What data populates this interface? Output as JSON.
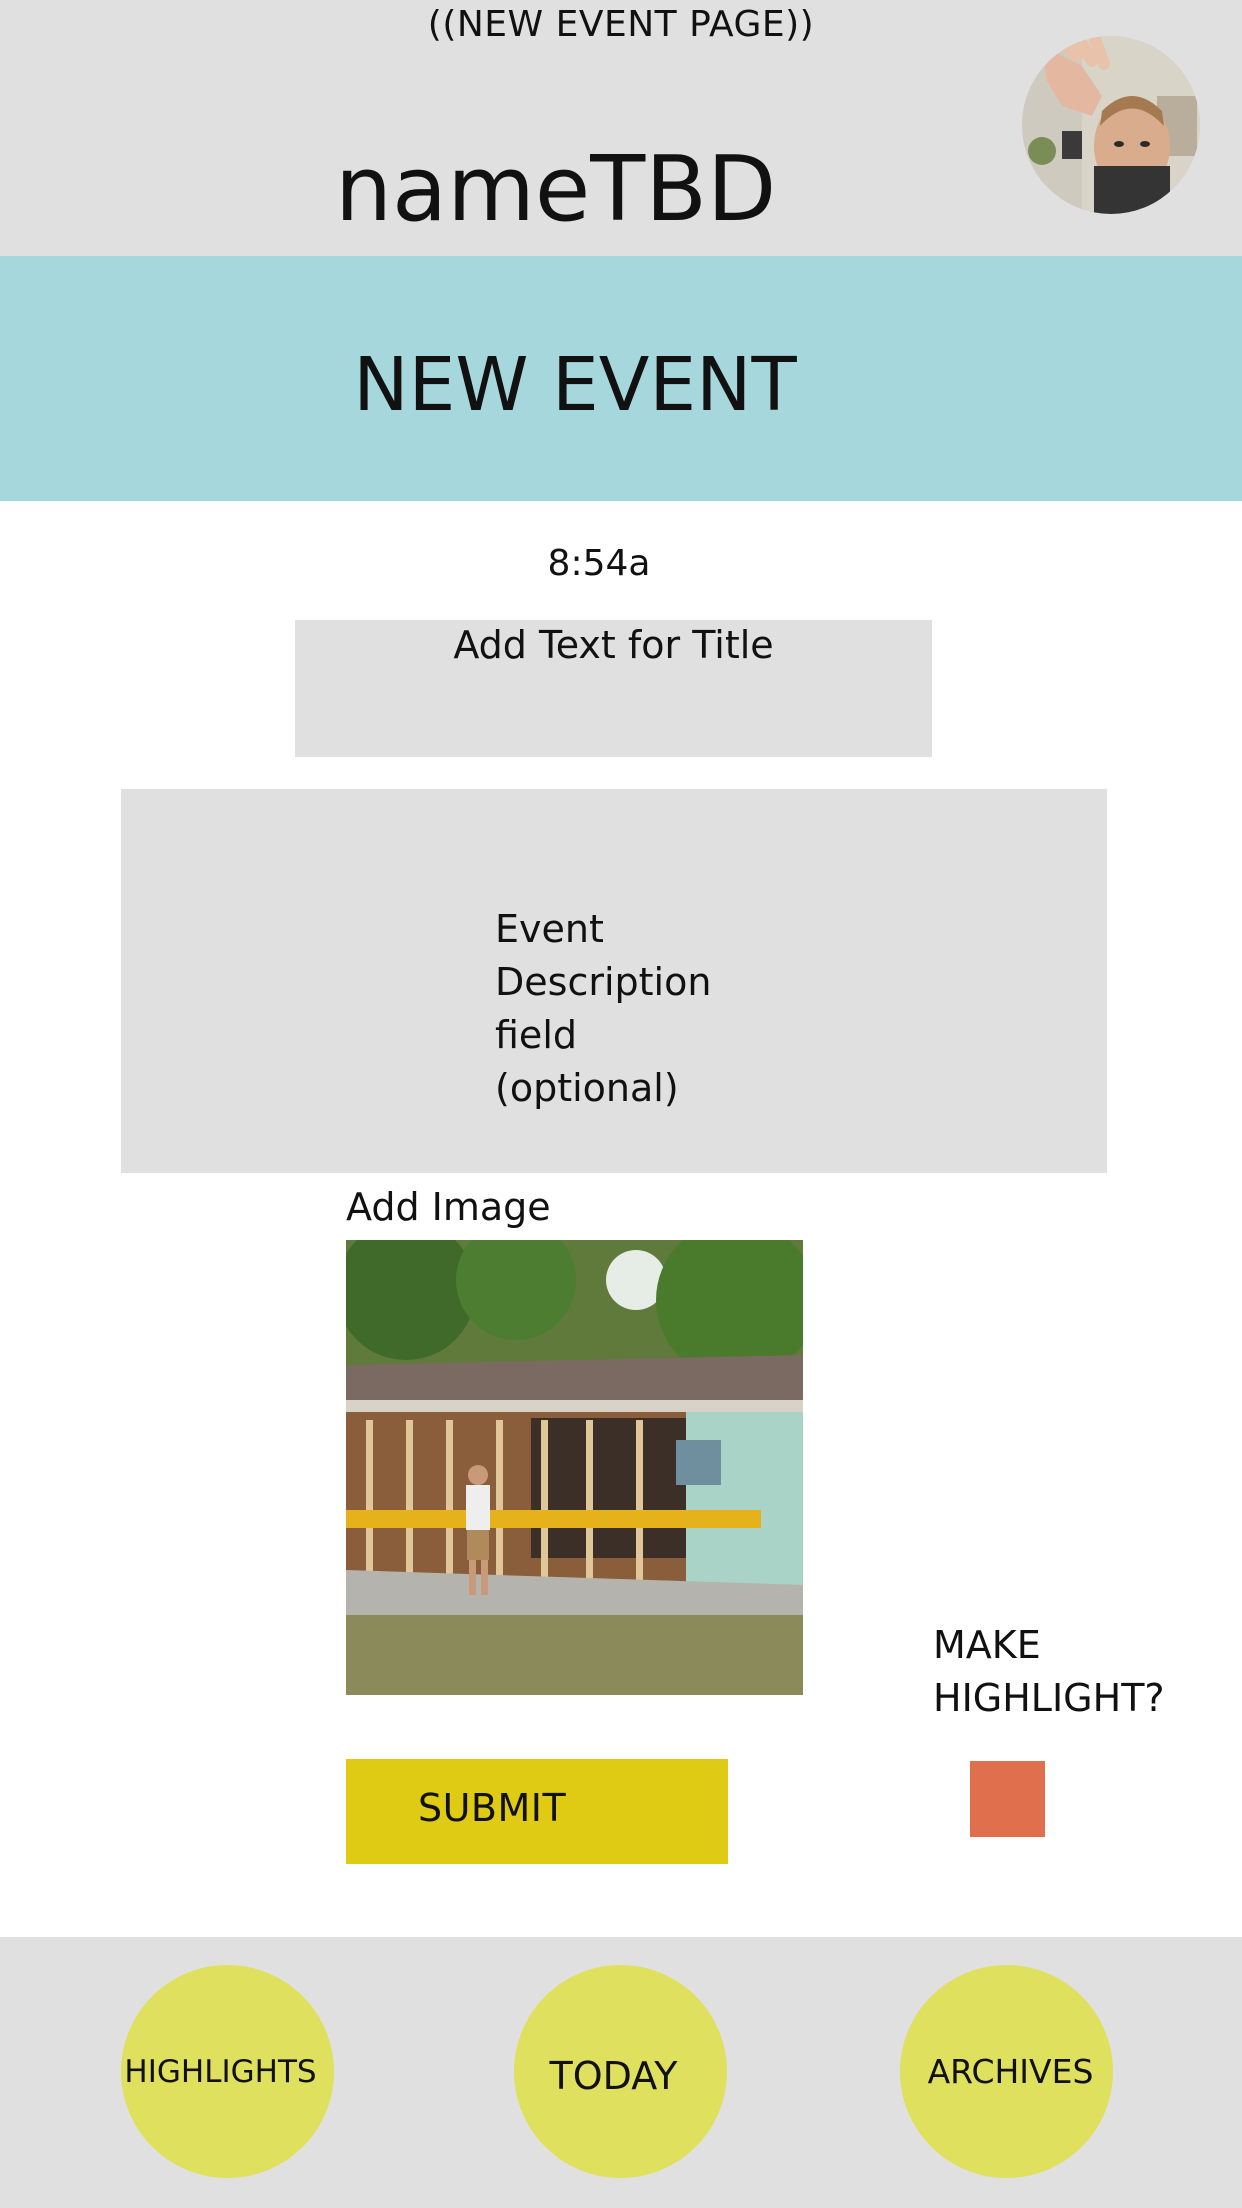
{
  "page_label": "((NEW EVENT PAGE))",
  "app_name": "nameTBD",
  "banner": {
    "title": "NEW EVENT"
  },
  "form": {
    "time": "8:54a",
    "title_placeholder": "Add Text for Title",
    "description_lines": [
      "Event",
      "Description",
      "field",
      "(optional)"
    ],
    "add_image_label": "Add Image",
    "submit_label": "SUBMIT",
    "highlight_label_lines": [
      "MAKE",
      "HIGHLIGHT?"
    ]
  },
  "nav": {
    "items": [
      {
        "label": "HIGHLIGHTS"
      },
      {
        "label": "TODAY"
      },
      {
        "label": "ARCHIVES"
      }
    ]
  },
  "colors": {
    "header_bg": "#e0e0e0",
    "banner_bg": "#a6d7dc",
    "submit_bg": "#dfca14",
    "checkbox_bg": "#e0704d",
    "nav_circle_bg": "#dfe05e"
  }
}
